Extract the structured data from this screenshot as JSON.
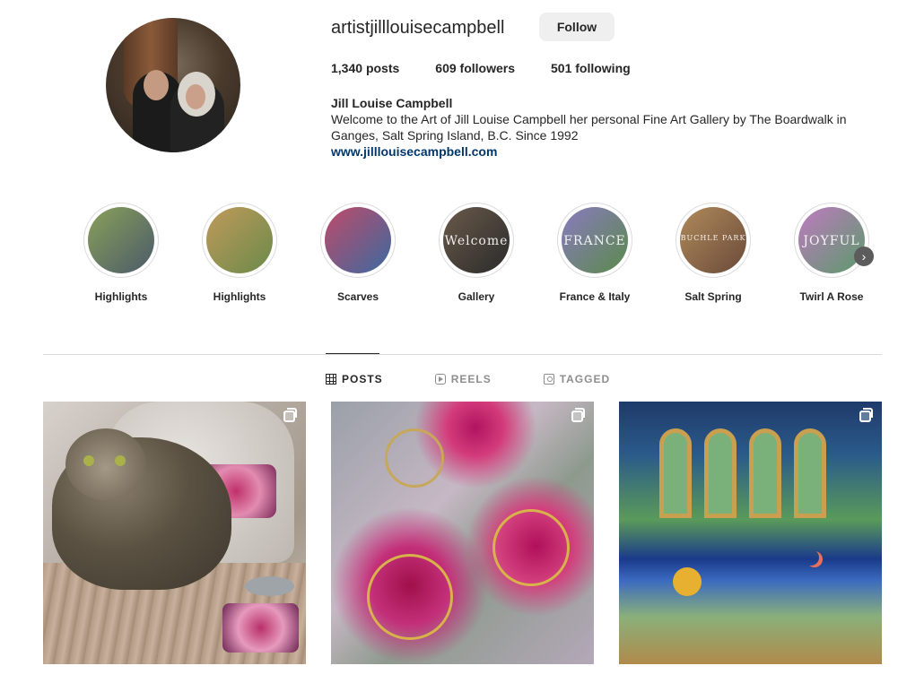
{
  "profile": {
    "username": "artistjilllouisecampbell",
    "follow_label": "Follow",
    "posts_count": "1,340",
    "posts_label": "posts",
    "followers_count": "609",
    "followers_label": "followers",
    "following_count": "501",
    "following_label": "following",
    "full_name": "Jill Louise Campbell",
    "bio": "Welcome to the Art of Jill Louise Campbell her personal Fine Art Gallery by The Boardwalk in Ganges, Salt Spring Island, B.C. Since 1992",
    "website": "www.jilllouisecampbell.com"
  },
  "highlights": [
    {
      "label": "Highlights",
      "overlay": "",
      "color_a": "#8aa05a",
      "color_b": "#4a5a6a"
    },
    {
      "label": "Highlights",
      "overlay": "",
      "color_a": "#c09a5a",
      "color_b": "#6a8a4a"
    },
    {
      "label": "Scarves",
      "overlay": "",
      "color_a": "#c04a6a",
      "color_b": "#3a6aa0"
    },
    {
      "label": "Gallery",
      "overlay": "Welcome",
      "color_a": "#6a5a4a",
      "color_b": "#2a2a2a"
    },
    {
      "label": "France & Italy",
      "overlay": "FRANCE",
      "color_a": "#8a7ac0",
      "color_b": "#5a8a4a"
    },
    {
      "label": "Salt Spring",
      "overlay": "BUCHLE PARK",
      "color_a": "#b08a5a",
      "color_b": "#6a4a3a"
    },
    {
      "label": "Twirl A Rose",
      "overlay": "JOYFUL",
      "color_a": "#c07ac0",
      "color_b": "#5a9a6a"
    }
  ],
  "tabs": [
    {
      "label": "POSTS",
      "icon": "grid-icon",
      "active": true
    },
    {
      "label": "REELS",
      "icon": "reels-icon",
      "active": false
    },
    {
      "label": "TAGGED",
      "icon": "tagged-icon",
      "active": false
    }
  ],
  "colors": {
    "link": "#00376b",
    "button_bg": "#efefef",
    "divider": "#dbdbdb"
  }
}
